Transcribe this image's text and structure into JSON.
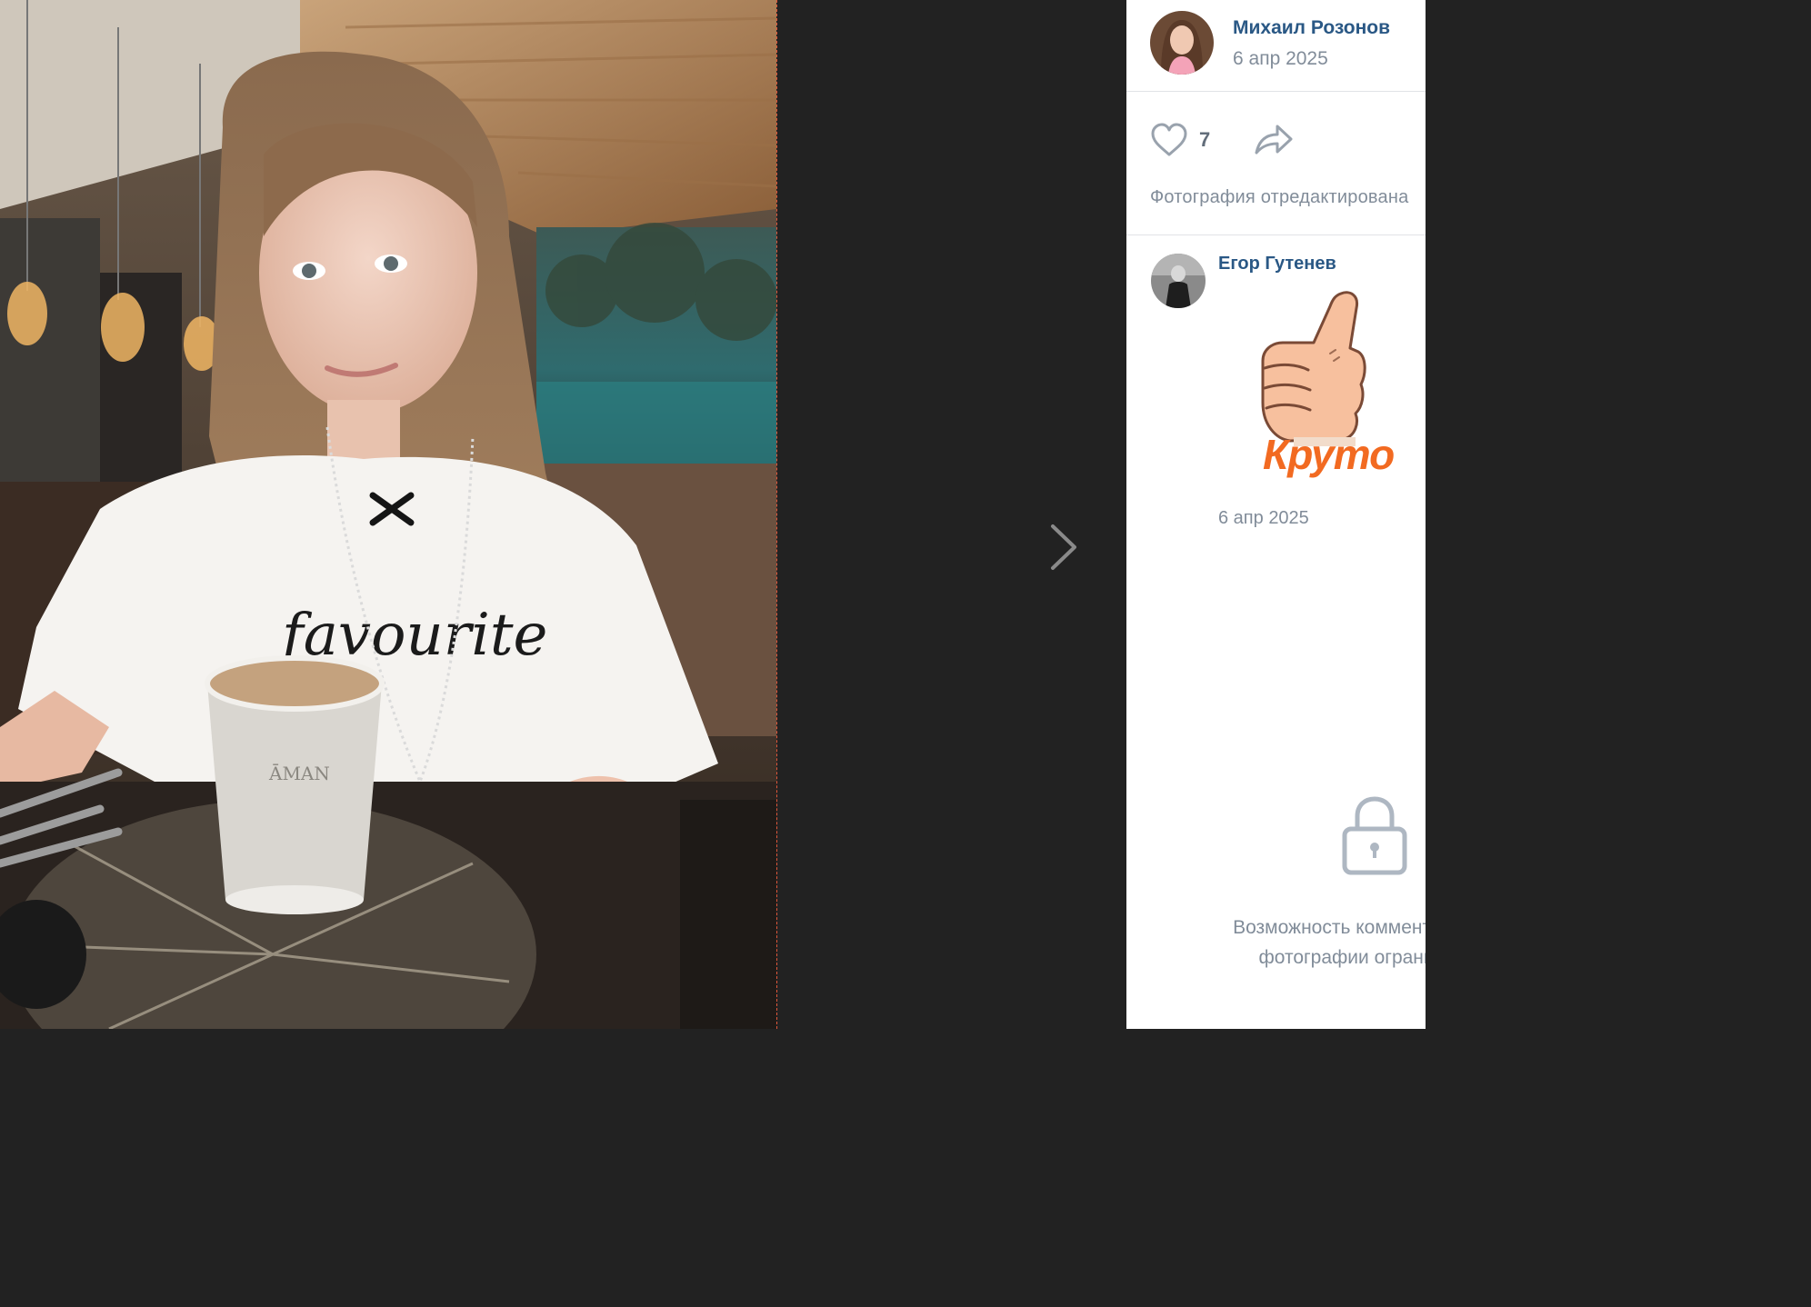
{
  "viewer": {
    "photo_alt": "Фотография",
    "next_icon": "chevron-right-icon"
  },
  "post": {
    "author_name": "Михаил Розонов",
    "date": "6 апр 2025",
    "likes": "7",
    "like_icon": "heart-icon",
    "share_icon": "share-arrow-icon",
    "edited_note": "Фотография отредактирована"
  },
  "comments": [
    {
      "author_name": "Егор Гутенев",
      "sticker_text": "Круто",
      "sticker_icon": "thumbs-up-icon",
      "date": "6 апр 2025"
    }
  ],
  "restriction": {
    "icon": "lock-icon",
    "line1": "Возможность комментировать",
    "line2": "фотографии ограничена"
  },
  "colors": {
    "viewer_bg": "#222222",
    "link": "#2a5885",
    "muted": "#818c99",
    "panel_bg": "#ffffff",
    "sticker_text": "#f26a21"
  }
}
